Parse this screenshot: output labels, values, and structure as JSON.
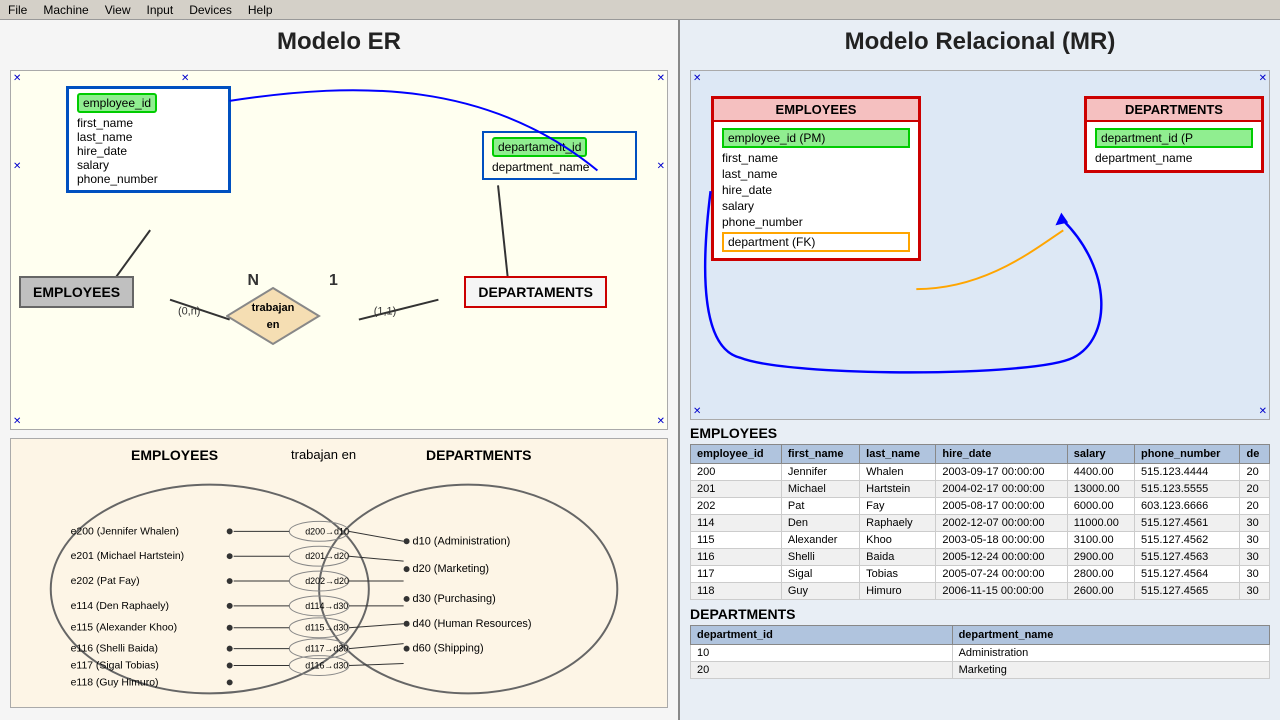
{
  "menubar": {
    "items": [
      "File",
      "Machine",
      "View",
      "Input",
      "Devices",
      "Help"
    ]
  },
  "left_panel": {
    "title": "Modelo ER",
    "er_diagram": {
      "employee_entity": {
        "pk": "employee_id",
        "fields": [
          "first_name",
          "last_name",
          "hire_date",
          "salary",
          "phone_number"
        ]
      },
      "dept_entity": {
        "pk": "departament_id",
        "fields": [
          "department_name"
        ]
      },
      "employees_rect": "EMPLOYEES",
      "departments_rect": "DEPARTAMENTS",
      "relationship": "trabajan en",
      "cardinality_left": "(0,n)",
      "cardinality_right": "(1,1)",
      "n_label": "N",
      "one_label": "1"
    },
    "venn": {
      "title_employees": "EMPLOYEES",
      "title_trabajan": "trabajan en",
      "title_departments": "DEPARTMENTS",
      "employees": [
        "e200 (Jennifer Whalen)",
        "e201 (Michael Hartstein)",
        "e202 (Pat Fay)",
        "e114 (Den Raphaely)",
        "e115 (Alexander Khoo)",
        "e116 (Shelli Baida)",
        "e117 (Sigal Tobias)",
        "e118 (Guy Himuro)"
      ],
      "departments": [
        "d10 (Administration)",
        "d20 (Marketing)",
        "d30 (Purchasing)",
        "d40 (Human Resources)",
        "d60 (Shipping)"
      ]
    }
  },
  "right_panel": {
    "title": "Modelo Relacional (MR)",
    "mr_diagram": {
      "employees_box": {
        "header": "EMPLOYEES",
        "pk": "employee_id (PM)",
        "fields": [
          "first_name",
          "last_name",
          "hire_date",
          "salary",
          "phone_number"
        ],
        "fk": "department (FK)"
      },
      "departments_box": {
        "header": "DEPARTMENTS",
        "pk": "department_id (P",
        "fields": [
          "department_name"
        ]
      }
    },
    "employees_table": {
      "title": "EMPLOYEES",
      "columns": [
        "employee_id",
        "first_name",
        "last_name",
        "hire_date",
        "salary",
        "phone_number",
        "de"
      ],
      "rows": [
        [
          "200",
          "Jennifer",
          "Whalen",
          "2003-09-17 00:00:00",
          "4400.00",
          "515.123.4444",
          "20"
        ],
        [
          "201",
          "Michael",
          "Hartstein",
          "2004-02-17 00:00:00",
          "13000.00",
          "515.123.5555",
          "20"
        ],
        [
          "202",
          "Pat",
          "Fay",
          "2005-08-17 00:00:00",
          "6000.00",
          "603.123.6666",
          "20"
        ],
        [
          "114",
          "Den",
          "Raphaely",
          "2002-12-07 00:00:00",
          "11000.00",
          "515.127.4561",
          "30"
        ],
        [
          "115",
          "Alexander",
          "Khoo",
          "2003-05-18 00:00:00",
          "3100.00",
          "515.127.4562",
          "30"
        ],
        [
          "116",
          "Shelli",
          "Baida",
          "2005-12-24 00:00:00",
          "2900.00",
          "515.127.4563",
          "30"
        ],
        [
          "117",
          "Sigal",
          "Tobias",
          "2005-07-24 00:00:00",
          "2800.00",
          "515.127.4564",
          "30"
        ],
        [
          "118",
          "Guy",
          "Himuro",
          "2006-11-15 00:00:00",
          "2600.00",
          "515.127.4565",
          "30"
        ]
      ]
    },
    "departments_table": {
      "title": "DEPARTMENTS",
      "columns": [
        "department_id",
        "department_name"
      ],
      "rows": [
        [
          "10",
          "Administration"
        ],
        [
          "20",
          "Marketing"
        ]
      ]
    }
  }
}
